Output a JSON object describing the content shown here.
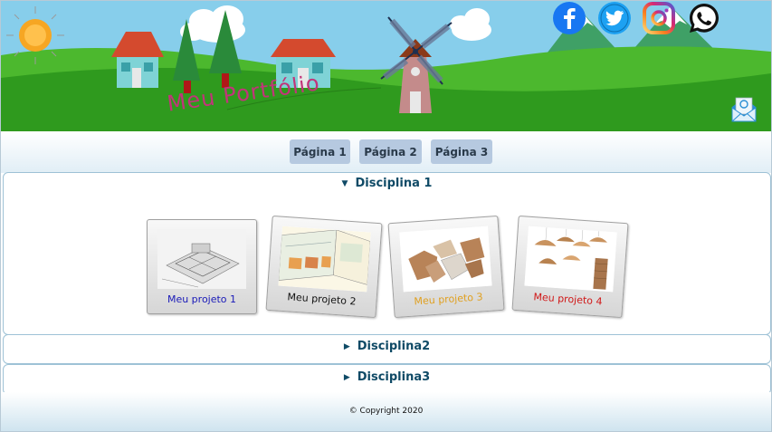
{
  "header": {
    "title": "Meu Portfólio",
    "social": [
      "facebook-icon",
      "twitter-icon",
      "instagram-icon",
      "whatsapp-icon",
      "email-icon"
    ]
  },
  "nav": {
    "items": [
      {
        "label": "Página 1"
      },
      {
        "label": "Página 2"
      },
      {
        "label": "Página 3"
      }
    ]
  },
  "sections": [
    {
      "label": "Disciplina 1",
      "expanded": true,
      "projects": [
        {
          "label": "Meu projeto 1",
          "color": "#1a1ab8"
        },
        {
          "label": "Meu projeto 2",
          "color": "#111111"
        },
        {
          "label": "Meu projeto 3",
          "color": "#e0a020"
        },
        {
          "label": "Meu projeto 4",
          "color": "#d01818"
        }
      ]
    },
    {
      "label": "Disciplina2",
      "expanded": false
    },
    {
      "label": "Disciplina3",
      "expanded": false
    }
  ],
  "footer": {
    "copyright": "© Copyright 2020"
  },
  "colors": {
    "nav_button": "#b6c9e0",
    "section_title": "#0f4a66",
    "title": "#c2347a"
  }
}
